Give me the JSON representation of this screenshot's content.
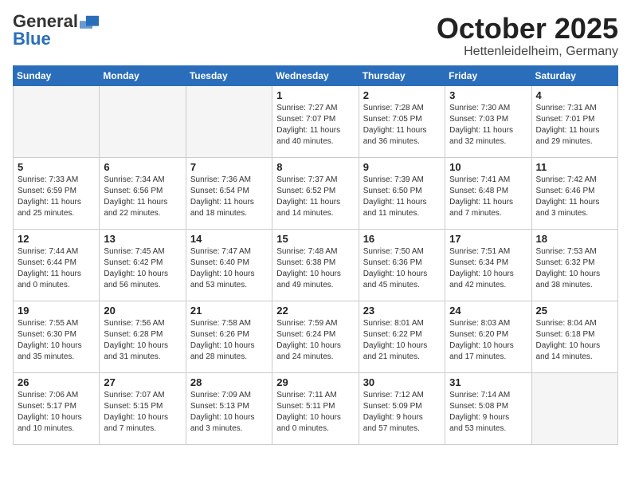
{
  "header": {
    "logo_general": "General",
    "logo_blue": "Blue",
    "month_title": "October 2025",
    "location": "Hettenleidelheim, Germany"
  },
  "calendar": {
    "days_of_week": [
      "Sunday",
      "Monday",
      "Tuesday",
      "Wednesday",
      "Thursday",
      "Friday",
      "Saturday"
    ],
    "weeks": [
      [
        {
          "day": null,
          "info": null
        },
        {
          "day": null,
          "info": null
        },
        {
          "day": null,
          "info": null
        },
        {
          "day": "1",
          "info": "Sunrise: 7:27 AM\nSunset: 7:07 PM\nDaylight: 11 hours\nand 40 minutes."
        },
        {
          "day": "2",
          "info": "Sunrise: 7:28 AM\nSunset: 7:05 PM\nDaylight: 11 hours\nand 36 minutes."
        },
        {
          "day": "3",
          "info": "Sunrise: 7:30 AM\nSunset: 7:03 PM\nDaylight: 11 hours\nand 32 minutes."
        },
        {
          "day": "4",
          "info": "Sunrise: 7:31 AM\nSunset: 7:01 PM\nDaylight: 11 hours\nand 29 minutes."
        }
      ],
      [
        {
          "day": "5",
          "info": "Sunrise: 7:33 AM\nSunset: 6:59 PM\nDaylight: 11 hours\nand 25 minutes."
        },
        {
          "day": "6",
          "info": "Sunrise: 7:34 AM\nSunset: 6:56 PM\nDaylight: 11 hours\nand 22 minutes."
        },
        {
          "day": "7",
          "info": "Sunrise: 7:36 AM\nSunset: 6:54 PM\nDaylight: 11 hours\nand 18 minutes."
        },
        {
          "day": "8",
          "info": "Sunrise: 7:37 AM\nSunset: 6:52 PM\nDaylight: 11 hours\nand 14 minutes."
        },
        {
          "day": "9",
          "info": "Sunrise: 7:39 AM\nSunset: 6:50 PM\nDaylight: 11 hours\nand 11 minutes."
        },
        {
          "day": "10",
          "info": "Sunrise: 7:41 AM\nSunset: 6:48 PM\nDaylight: 11 hours\nand 7 minutes."
        },
        {
          "day": "11",
          "info": "Sunrise: 7:42 AM\nSunset: 6:46 PM\nDaylight: 11 hours\nand 3 minutes."
        }
      ],
      [
        {
          "day": "12",
          "info": "Sunrise: 7:44 AM\nSunset: 6:44 PM\nDaylight: 11 hours\nand 0 minutes."
        },
        {
          "day": "13",
          "info": "Sunrise: 7:45 AM\nSunset: 6:42 PM\nDaylight: 10 hours\nand 56 minutes."
        },
        {
          "day": "14",
          "info": "Sunrise: 7:47 AM\nSunset: 6:40 PM\nDaylight: 10 hours\nand 53 minutes."
        },
        {
          "day": "15",
          "info": "Sunrise: 7:48 AM\nSunset: 6:38 PM\nDaylight: 10 hours\nand 49 minutes."
        },
        {
          "day": "16",
          "info": "Sunrise: 7:50 AM\nSunset: 6:36 PM\nDaylight: 10 hours\nand 45 minutes."
        },
        {
          "day": "17",
          "info": "Sunrise: 7:51 AM\nSunset: 6:34 PM\nDaylight: 10 hours\nand 42 minutes."
        },
        {
          "day": "18",
          "info": "Sunrise: 7:53 AM\nSunset: 6:32 PM\nDaylight: 10 hours\nand 38 minutes."
        }
      ],
      [
        {
          "day": "19",
          "info": "Sunrise: 7:55 AM\nSunset: 6:30 PM\nDaylight: 10 hours\nand 35 minutes."
        },
        {
          "day": "20",
          "info": "Sunrise: 7:56 AM\nSunset: 6:28 PM\nDaylight: 10 hours\nand 31 minutes."
        },
        {
          "day": "21",
          "info": "Sunrise: 7:58 AM\nSunset: 6:26 PM\nDaylight: 10 hours\nand 28 minutes."
        },
        {
          "day": "22",
          "info": "Sunrise: 7:59 AM\nSunset: 6:24 PM\nDaylight: 10 hours\nand 24 minutes."
        },
        {
          "day": "23",
          "info": "Sunrise: 8:01 AM\nSunset: 6:22 PM\nDaylight: 10 hours\nand 21 minutes."
        },
        {
          "day": "24",
          "info": "Sunrise: 8:03 AM\nSunset: 6:20 PM\nDaylight: 10 hours\nand 17 minutes."
        },
        {
          "day": "25",
          "info": "Sunrise: 8:04 AM\nSunset: 6:18 PM\nDaylight: 10 hours\nand 14 minutes."
        }
      ],
      [
        {
          "day": "26",
          "info": "Sunrise: 7:06 AM\nSunset: 5:17 PM\nDaylight: 10 hours\nand 10 minutes."
        },
        {
          "day": "27",
          "info": "Sunrise: 7:07 AM\nSunset: 5:15 PM\nDaylight: 10 hours\nand 7 minutes."
        },
        {
          "day": "28",
          "info": "Sunrise: 7:09 AM\nSunset: 5:13 PM\nDaylight: 10 hours\nand 3 minutes."
        },
        {
          "day": "29",
          "info": "Sunrise: 7:11 AM\nSunset: 5:11 PM\nDaylight: 10 hours\nand 0 minutes."
        },
        {
          "day": "30",
          "info": "Sunrise: 7:12 AM\nSunset: 5:09 PM\nDaylight: 9 hours\nand 57 minutes."
        },
        {
          "day": "31",
          "info": "Sunrise: 7:14 AM\nSunset: 5:08 PM\nDaylight: 9 hours\nand 53 minutes."
        },
        {
          "day": null,
          "info": null
        }
      ]
    ]
  }
}
